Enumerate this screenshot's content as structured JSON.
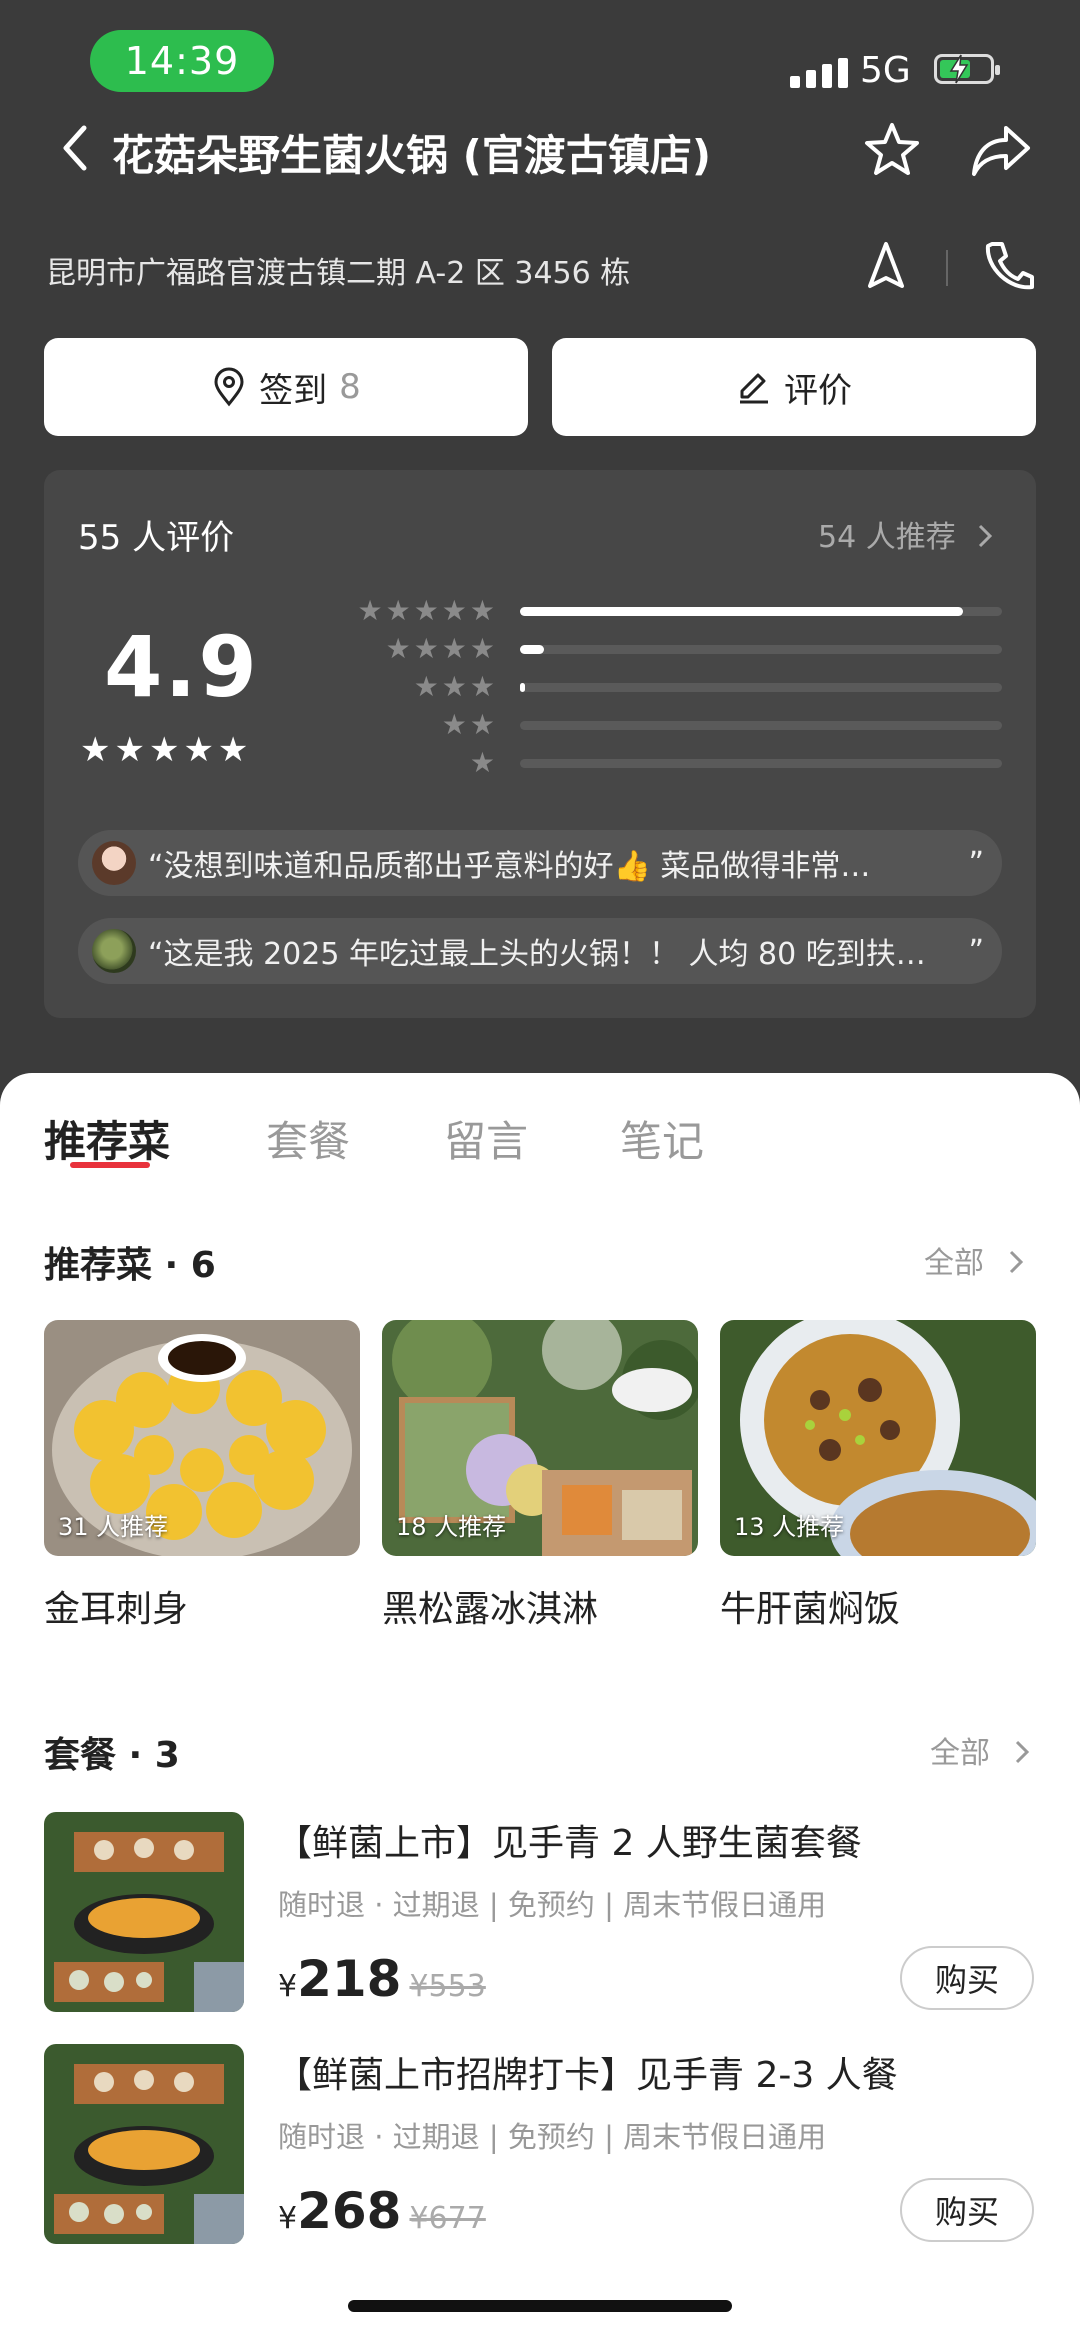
{
  "status_bar": {
    "time": "14:39",
    "network": "5G"
  },
  "header": {
    "title": "花菇朵野生菌火锅 (官渡古镇店)",
    "address": "昆明市广福路官渡古镇二期 A-2 区 3456 栋"
  },
  "actions": {
    "checkin_label": "签到",
    "checkin_count": "8",
    "review_label": "评价"
  },
  "rating": {
    "reviews_label": "55 人评价",
    "recommend_link": "54 人推荐",
    "score": "4.9",
    "score_stars": "★★★★★",
    "distribution": [
      {
        "stars": "★★★★★",
        "fraction": 0.92
      },
      {
        "stars": "★★★★",
        "fraction": 0.05
      },
      {
        "stars": "★★★",
        "fraction": 0.01
      },
      {
        "stars": "★★",
        "fraction": 0
      },
      {
        "stars": "★",
        "fraction": 0
      }
    ],
    "quotes": [
      "“没想到味道和品质都出乎意料的好👍 菜品做得非常…",
      "“这是我 2025 年吃过最上头的火锅！！ 人均 80 吃到扶…"
    ],
    "quote_end": "”"
  },
  "tabs": [
    "推荐菜",
    "套餐",
    "留言",
    "笔记"
  ],
  "dishes_section": {
    "title": "推荐菜 · 6",
    "link": "全部",
    "items": [
      {
        "tag": "31 人推荐",
        "name": "金耳刺身"
      },
      {
        "tag": "18 人推荐",
        "name": "黑松露冰淇淋"
      },
      {
        "tag": "13 人推荐",
        "name": "牛肝菌焖饭"
      }
    ]
  },
  "sets_section": {
    "title": "套餐 · 3",
    "link": "全部",
    "items": [
      {
        "title": "【鲜菌上市】见手青 2 人野生菌套餐",
        "tags": "随时退 · 过期退 | 免预约 | 周末节假日通用",
        "currency": "¥",
        "price": "218",
        "original": "¥553",
        "buy": "购买"
      },
      {
        "title": "【鲜菌上市招牌打卡】见手青 2-3 人餐",
        "tags": "随时退 · 过期退 | 免预约 | 周末节假日通用",
        "currency": "¥",
        "price": "268",
        "original": "¥677",
        "buy": "购买"
      }
    ]
  },
  "colors": {
    "accent": "#e8323c",
    "time_pill": "#2dbd4e",
    "dark_bg": "#3b3b3b"
  },
  "icons": [
    "back-icon",
    "star-icon",
    "share-icon",
    "navigate-icon",
    "phone-icon",
    "location-pin-icon",
    "edit-icon",
    "chevron-right-icon"
  ]
}
